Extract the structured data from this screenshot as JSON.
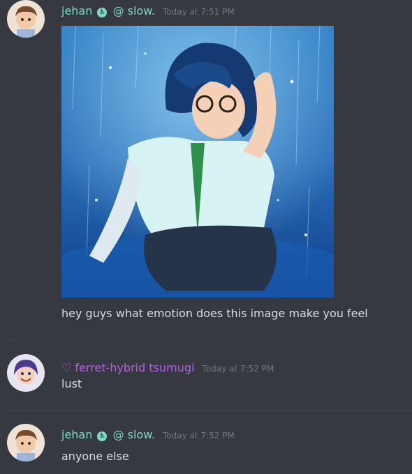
{
  "messages": [
    {
      "username": "jehan",
      "badge_icon": "wheelchair-icon",
      "suffix": "@ slow.",
      "timestamp": "Today at 7:51 PM",
      "text": "hey guys what emotion does this image make you feel",
      "has_image": true
    },
    {
      "username": "♡ ferret-hybrid tsumugi",
      "timestamp": "Today at 7:52 PM",
      "text": "lust"
    },
    {
      "username": "jehan",
      "badge_icon": "wheelchair-icon",
      "suffix": "@ slow.",
      "timestamp": "Today at 7:52 PM",
      "text": "anyone else"
    }
  ],
  "colors": {
    "background": "#36393f",
    "username_teal": "#7fd8c8",
    "username_purple": "#b65ee8",
    "timestamp": "#72767d",
    "text": "#dcddde"
  }
}
